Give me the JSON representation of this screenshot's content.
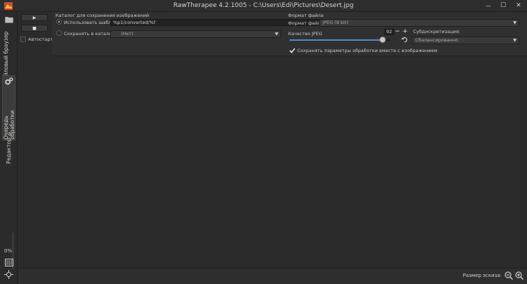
{
  "window": {
    "title": "RawTherapee 4.2.1005 - C:\\Users\\Edi\\Pictures\\Desert.jpg",
    "min_glyph": "—",
    "max_glyph": "☐",
    "close_glyph": "✕"
  },
  "side_tabs": [
    {
      "label": "Файловый браузер (8)"
    },
    {
      "label": "Очередь обработки"
    },
    {
      "label": "Редактор"
    }
  ],
  "queue_controls": {
    "play_glyph": "▶",
    "stop_glyph": "■",
    "autostart_label": "Автостарт",
    "progress": "0%"
  },
  "output_dir": {
    "section_title": "Каталог для сохранения изображений",
    "template_label": "Использовать шаблон:",
    "template_value": "%p1/converted/%f",
    "save_to_label": "Сохранять в каталог:",
    "folder_value": "(Нет)"
  },
  "file_format": {
    "section_title": "Формат файла",
    "format_label": "Формат файла:",
    "format_value": "JPEG (8 bit)",
    "quality_label": "Качество JPEG",
    "quality_value": "92",
    "quality_fraction": 0.92,
    "subsampling_label": "Субдискретизация:",
    "subsampling_value": "Сбалансированно",
    "save_params_label": "Сохранять параметры обработки вместе с изображением",
    "save_params_checked": true
  },
  "status": {
    "zoom_label": "Размер эскиза:"
  },
  "colors": {
    "accent": "#4e8bd4",
    "background": "#2b2b2b",
    "panel": "#303030"
  }
}
